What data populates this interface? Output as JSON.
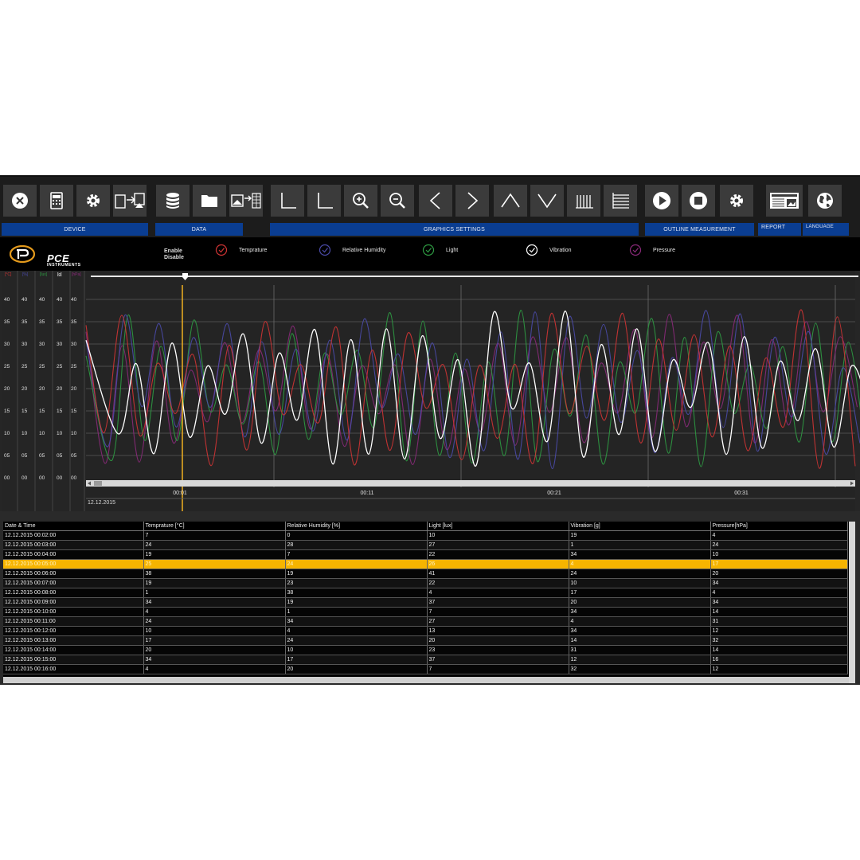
{
  "sections": {
    "device": "DEVICE",
    "data": "DATA",
    "graphics": "GRAPHICS SETTINGS",
    "outline": "OUTLINE MEASUREMENT",
    "report": "REPORT",
    "language": "LANGUAGE"
  },
  "toolbar_icons": [
    "close-icon",
    "device-icon",
    "gear-icon",
    "transfer-icon",
    "database-icon",
    "folder-icon",
    "export-icon",
    "axis-icon",
    "axis-icon",
    "zoom-in-icon",
    "zoom-out-icon",
    "chevron-left-icon",
    "chevron-right-icon",
    "chevron-up-icon",
    "chevron-down-icon",
    "vertical-lines-icon",
    "horizontal-lines-icon",
    "play-icon",
    "stop-icon",
    "gear-icon",
    "report-icon",
    "globe-icon"
  ],
  "logo": {
    "name": "PCE",
    "sub": "INSTRUMENTS"
  },
  "enable_label": {
    "line1": "Enable",
    "line2": "Disable"
  },
  "legend": [
    {
      "label": "Temprature",
      "color": "#d03434"
    },
    {
      "label": "Relative Humidity",
      "color": "#4a4aa8"
    },
    {
      "label": "Light",
      "color": "#2e9a42"
    },
    {
      "label": "Vibration",
      "color": "#ffffff"
    },
    {
      "label": "Pressure",
      "color": "#8a2a7a"
    }
  ],
  "chart_data": {
    "type": "line",
    "units": [
      "[°C]",
      "[%]",
      "[lux]",
      "[g]",
      "[hPa]"
    ],
    "y_ticks": [
      "40",
      "35",
      "30",
      "25",
      "20",
      "15",
      "10",
      "05",
      "00"
    ],
    "x_ticks": [
      "00:01",
      "00:11",
      "00:21",
      "00:31"
    ],
    "start_date": "12.12.2015",
    "ylim": [
      0,
      40
    ]
  },
  "table": {
    "headers": [
      "Date & Time",
      "Temprature [°C]",
      "Relative Humidity [%]",
      "Light [lux]",
      "Vibration [g]",
      "Pressure[hPa]"
    ],
    "rows": [
      [
        "12.12.2015 00:02:00",
        "7",
        "0",
        "10",
        "19",
        "4"
      ],
      [
        "12.12.2015 00:03:00",
        "24",
        "28",
        "27",
        "1",
        "24"
      ],
      [
        "12.12.2015 00:04:00",
        "19",
        "7",
        "22",
        "34",
        "10"
      ],
      [
        "12.12.2015 00:05:00",
        "25",
        "24",
        "26",
        "4",
        "17"
      ],
      [
        "12.12.2015 00:06:00",
        "38",
        "19",
        "41",
        "24",
        "20"
      ],
      [
        "12.12.2015 00:07:00",
        "19",
        "23",
        "22",
        "10",
        "34"
      ],
      [
        "12.12.2015 00:08:00",
        "1",
        "38",
        "4",
        "17",
        "4"
      ],
      [
        "12.12.2015 00:09:00",
        "34",
        "19",
        "37",
        "20",
        "34"
      ],
      [
        "12.12.2015 00:10:00",
        "4",
        "1",
        "7",
        "34",
        "14"
      ],
      [
        "12.12.2015 00:11:00",
        "24",
        "34",
        "27",
        "4",
        "31"
      ],
      [
        "12.12.2015 00:12:00",
        "10",
        "4",
        "13",
        "34",
        "12"
      ],
      [
        "12.12.2015 00:13:00",
        "17",
        "24",
        "20",
        "14",
        "32"
      ],
      [
        "12.12.2015 00:14:00",
        "20",
        "10",
        "23",
        "31",
        "14"
      ],
      [
        "12.12.2015 00:15:00",
        "34",
        "17",
        "37",
        "12",
        "16"
      ],
      [
        "12.12.2015 00:16:00",
        "4",
        "20",
        "7",
        "32",
        "12"
      ]
    ],
    "selected_row": 3
  }
}
